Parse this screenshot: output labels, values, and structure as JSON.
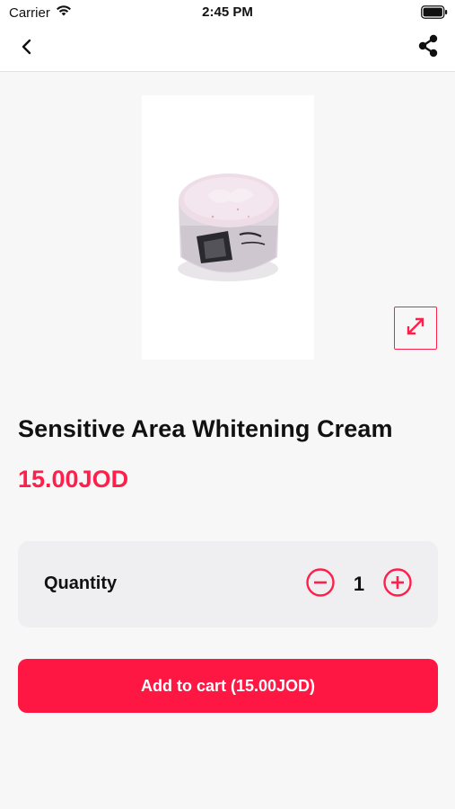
{
  "status_bar": {
    "carrier": "Carrier",
    "time": "2:45 PM",
    "icons": [
      "wifi-icon",
      "battery-icon"
    ]
  },
  "nav": {
    "back_icon": "chevron-left-icon",
    "share_icon": "share-icon"
  },
  "product": {
    "image_icon": "cream-jar-image",
    "expand_icon": "expand-icon",
    "title": "Sensitive Area Whitening Cream",
    "price": "15.00JOD"
  },
  "quantity": {
    "label": "Quantity",
    "value": "1",
    "decrement_icon": "minus-circle-icon",
    "increment_icon": "plus-circle-icon"
  },
  "cart": {
    "button_label": "Add to cart (15.00JOD)"
  },
  "colors": {
    "accent": "#ff1744",
    "background": "#f7f7f7",
    "card": "#efeff1"
  }
}
